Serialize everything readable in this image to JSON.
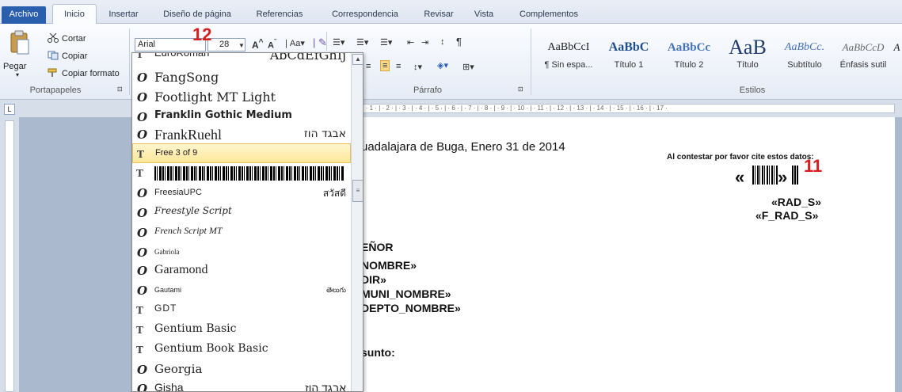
{
  "tabs": [
    "Archivo",
    "Inicio",
    "Insertar",
    "Diseño de página",
    "Referencias",
    "Correspondencia",
    "Revisar",
    "Vista",
    "Complementos"
  ],
  "clipboard": {
    "paste": "Pegar",
    "cut": "Cortar",
    "copy": "Copiar",
    "format_painter": "Copiar formato",
    "group": "Portapapeles"
  },
  "font": {
    "name": "Arial",
    "size": "28"
  },
  "paragraph_group": "Párrafo",
  "styles": {
    "group": "Estilos",
    "items": [
      {
        "preview": "AaBbCcI",
        "name": "¶ Sin espa..."
      },
      {
        "preview": "AaBbC",
        "name": "Título 1"
      },
      {
        "preview": "AaBbCc",
        "name": "Título 2"
      },
      {
        "preview": "AaB",
        "name": "Título"
      },
      {
        "preview": "AaBbCc.",
        "name": "Subtítulo"
      },
      {
        "preview": "AaBbCcD",
        "name": "Énfasis sutil"
      },
      {
        "preview": "A",
        "name": ""
      }
    ]
  },
  "annotations": {
    "font_size_marker": "12",
    "barcode_marker": "11"
  },
  "ruler_text": "· 1 · | · 1 · | · 2 · | · 3 · | · 4 · | · 5 · | · 6 · | · 7 · | · 8 · | · 9 · | · 10 · | · 11 · | · 12 · | · 13 · | · 14 · | · 15 · | · 16 · | · 17 ·",
  "font_list": [
    {
      "name": "EuroRoman",
      "sample": "AbCdEfGhIj",
      "type": "tt"
    },
    {
      "name": "FangSong",
      "sample": "",
      "type": "o"
    },
    {
      "name": "Footlight MT Light",
      "sample": "",
      "type": "o"
    },
    {
      "name": "Franklin Gothic Medium",
      "sample": "",
      "type": "o"
    },
    {
      "name": "FrankRuehl",
      "sample": "אבגד הוז",
      "type": "o"
    },
    {
      "name": "Free 3 of 9",
      "sample": "",
      "type": "tt",
      "selected": true
    },
    {
      "name": "",
      "sample": "",
      "type": "tt",
      "barcode": true
    },
    {
      "name": "FreesiaUPC",
      "sample": "สวัสดี",
      "type": "o"
    },
    {
      "name": "Freestyle Script",
      "sample": "",
      "type": "o"
    },
    {
      "name": "French Script MT",
      "sample": "",
      "type": "o"
    },
    {
      "name": "Gabriola",
      "sample": "",
      "type": "o"
    },
    {
      "name": "Garamond",
      "sample": "",
      "type": "o"
    },
    {
      "name": "Gautami",
      "sample": "తెలుగు",
      "type": "o"
    },
    {
      "name": "GDT",
      "sample": "",
      "type": "tt"
    },
    {
      "name": "Gentium Basic",
      "sample": "",
      "type": "tt"
    },
    {
      "name": "Gentium Book Basic",
      "sample": "",
      "type": "tt"
    },
    {
      "name": "Georgia",
      "sample": "",
      "type": "o"
    },
    {
      "name": "Gisha",
      "sample": "אבגד הוז",
      "type": "o"
    }
  ],
  "document": {
    "date_line": "uadalajara de Buga, Enero 31 de 2014",
    "cite_notice": "Al contestar por favor cite estos datos:",
    "barcode_left": "«",
    "barcode_right": "»",
    "rad_s": "«RAD_S»",
    "f_rad_s": "«F_RAD_S»",
    "addressee": [
      "EÑOR",
      "NOMBRE»",
      "DIR»",
      "MUNI_NOMBRE»",
      "DEPTO_NOMBRE»"
    ],
    "subject": "sunto:"
  }
}
